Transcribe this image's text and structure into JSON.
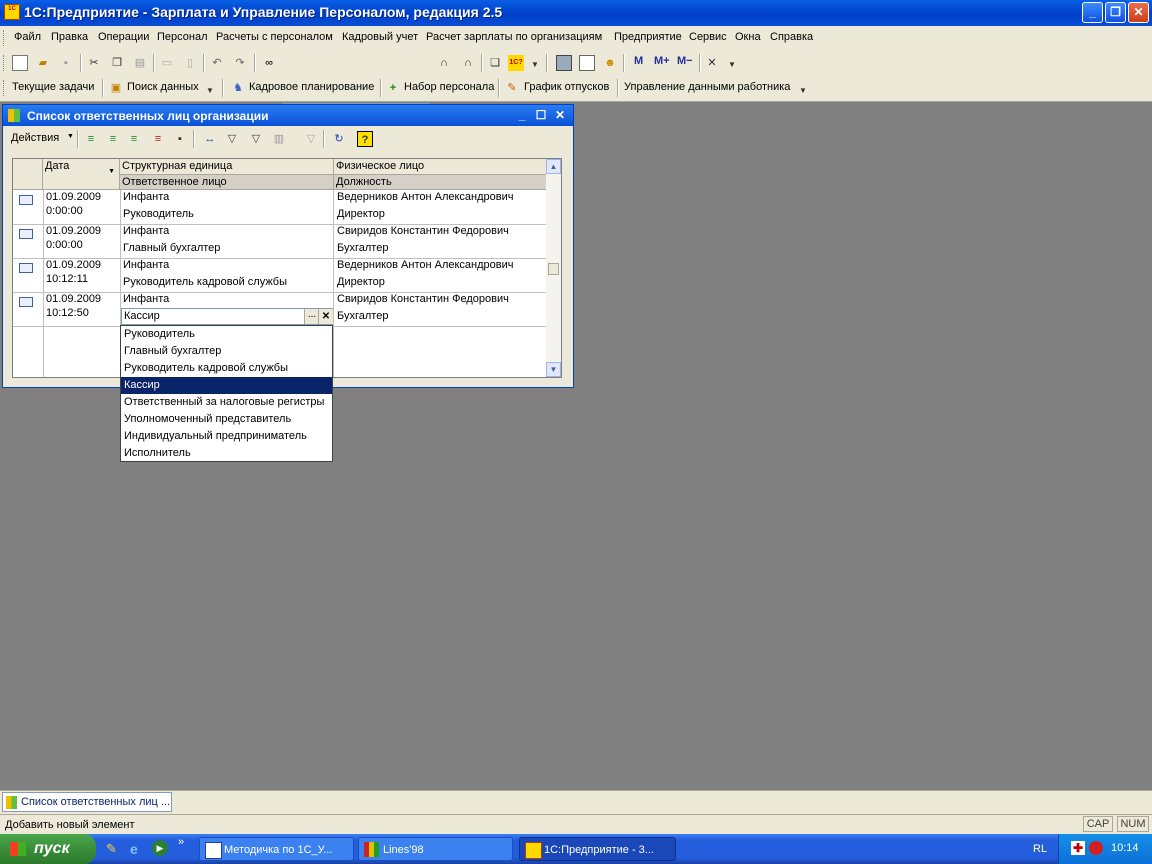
{
  "app": {
    "title": "1С:Предприятие - Зарплата и Управление Персоналом, редакция 2.5",
    "icon_text": "1С V8",
    "window_buttons": {
      "minimize": "_",
      "restore": "❐",
      "close": "✕"
    }
  },
  "menu": [
    "Файл",
    "Правка",
    "Операции",
    "Персонал",
    "Расчеты с персоналом",
    "Кадровый учет",
    "Расчет зарплаты по организациям",
    "Предприятие",
    "Сервис",
    "Окна",
    "Справка"
  ],
  "toolbar2": {
    "items": [
      "Текущие задачи",
      "Поиск данных",
      "Кадровое планирование",
      "Набор персонала",
      "График отпусков",
      "Управление данными работника"
    ]
  },
  "toolbar1": {
    "search_value": "",
    "m_buttons": [
      "M",
      "M+",
      "M−"
    ]
  },
  "child_window": {
    "title": "Список ответственных лиц организации",
    "actions_label": "Действия"
  },
  "grid": {
    "headers": {
      "date": "Дата",
      "unit": "Структурная единица",
      "person": "Физическое лицо",
      "responsible": "Ответственное лицо",
      "position": "Должность"
    },
    "rows": [
      {
        "date": "01.09.2009",
        "time": "0:00:00",
        "unit": "Инфанта",
        "responsible": "Руководитель",
        "person": "Ведерников Антон Александрович",
        "position": "Директор"
      },
      {
        "date": "01.09.2009",
        "time": "0:00:00",
        "unit": "Инфанта",
        "responsible": "Главный бухгалтер",
        "person": "Свиридов Константин Федорович",
        "position": "Бухгалтер"
      },
      {
        "date": "01.09.2009",
        "time": "10:12:11",
        "unit": "Инфанта",
        "responsible": "Руководитель кадровой службы",
        "person": "Ведерников Антон Александрович",
        "position": "Директор"
      },
      {
        "date": "01.09.2009",
        "time": "10:12:50",
        "unit": "Инфанта",
        "responsible": "Кассир",
        "person": "Свиридов Константин Федорович",
        "position": "Бухгалтер"
      }
    ],
    "edit_buttons": {
      "select": "...",
      "clear": "✕"
    }
  },
  "dropdown": {
    "items": [
      "Руководитель",
      "Главный бухгалтер",
      "Руководитель кадровой службы",
      "Кассир",
      "Ответственный за налоговые регистры",
      "Уполномоченный представитель",
      "Индивидуальный предприниматель",
      "Исполнитель"
    ],
    "selected": "Кассир"
  },
  "window_panel": {
    "item": "Список ответственных лиц ..."
  },
  "status": {
    "text": "Добавить новый элемент",
    "cap": "CAP",
    "num": "NUM"
  },
  "taskbar": {
    "start": "пуск",
    "tasks": [
      "Методичка по 1С_У...",
      "Lines'98",
      "1С:Предприятие - 3..."
    ],
    "lang": "RL",
    "clock": "10:14"
  },
  "colors": {
    "titlebar": "#0a5fe6",
    "selection": "#0a246a",
    "desktop": "#808080",
    "chrome": "#ece9d8"
  }
}
